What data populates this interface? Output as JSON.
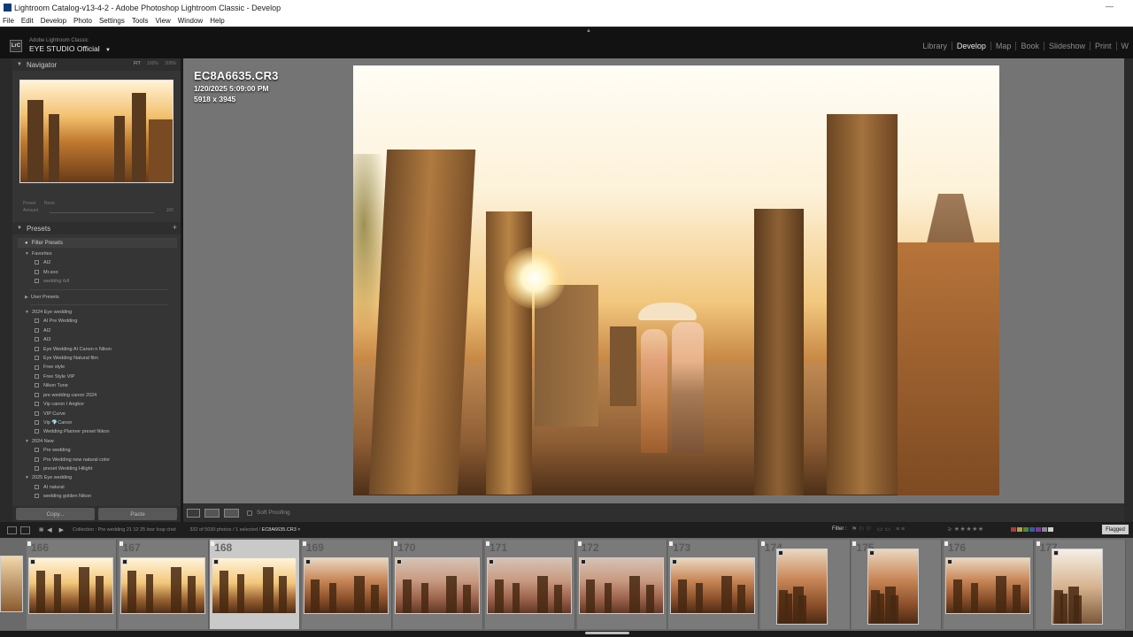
{
  "window": {
    "title": "Lightroom Catalog-v13-4-2 - Adobe Photoshop Lightroom Classic - Develop",
    "minimize": "—"
  },
  "menu": [
    "File",
    "Edit",
    "Develop",
    "Photo",
    "Settings",
    "Tools",
    "View",
    "Window",
    "Help"
  ],
  "identity": {
    "badge": "LrC",
    "app_small": "Adobe Lightroom Classic",
    "studio": "EYE STUDIO Official",
    "caret": "▼"
  },
  "modules": [
    "Library",
    "Develop",
    "Map",
    "Book",
    "Slideshow",
    "Print",
    "W"
  ],
  "active_module": "Develop",
  "navigator": {
    "title": "Navigator",
    "zoom_fit": "FIT",
    "zoom_100": "100%",
    "zoom_200": "200%"
  },
  "preset_strength": {
    "preset_label": "Preset",
    "preset_value": "None",
    "amount_label": "Amount",
    "amount_value": "100"
  },
  "presets": {
    "title": "Presets",
    "filter": "Filter Presets",
    "tree": [
      {
        "type": "group",
        "label": "Favorites"
      },
      {
        "type": "item",
        "label": "AI2"
      },
      {
        "type": "item",
        "label": "Mr.soo"
      },
      {
        "type": "item",
        "label": "wedding full",
        "dim": true
      },
      {
        "type": "sep"
      },
      {
        "type": "group",
        "label": "User Presets",
        "collapsed": true
      },
      {
        "type": "sep"
      },
      {
        "type": "group",
        "label": "2024 Eye wedding"
      },
      {
        "type": "item",
        "label": "AI Pre Wedding"
      },
      {
        "type": "item",
        "label": "AI2"
      },
      {
        "type": "item",
        "label": "AI3"
      },
      {
        "type": "item",
        "label": "Eye Wedding AI Canon n Nikon"
      },
      {
        "type": "item",
        "label": "Eye Wedding Natural film"
      },
      {
        "type": "item",
        "label": "Free style"
      },
      {
        "type": "item",
        "label": "Free Style VIP"
      },
      {
        "type": "item",
        "label": "Nikon Tune"
      },
      {
        "type": "item",
        "label": "pre wedding canon 2024"
      },
      {
        "type": "item",
        "label": "Vip canon I Angkor"
      },
      {
        "type": "item",
        "label": "VIP Curve"
      },
      {
        "type": "item",
        "label": "Vip 💎Canon"
      },
      {
        "type": "item",
        "label": "Wedding Planner preset Nikon"
      },
      {
        "type": "group",
        "label": "2024 New"
      },
      {
        "type": "item",
        "label": "Pre wedding"
      },
      {
        "type": "item",
        "label": "Pre Wedding new natural color"
      },
      {
        "type": "item",
        "label": "preset Wedding Hilight"
      },
      {
        "type": "group",
        "label": "2025 Eye wedding"
      },
      {
        "type": "item",
        "label": "AI natural"
      },
      {
        "type": "item",
        "label": "wedding golden Nikon"
      }
    ]
  },
  "buttons": {
    "copy": "Copy...",
    "paste": "Paste"
  },
  "photo_info": {
    "filename": "EC8A6635.CR3",
    "datetime": "1/20/2025 5:09:00 PM",
    "dimensions": "5918 x 3945"
  },
  "toolbar": {
    "soft_proofing": "Soft Proofing"
  },
  "filmstrip_bar": {
    "collection": "Collection : Pre wedding 21 12 25 loor loop chet",
    "count": "332 of 5030 photos / 1 selected /",
    "current": "EC8A6635.CR3",
    "filter_label": "Filter :",
    "stars": "≥ ★★★★★",
    "flagged": "Flagged",
    "label_colors": [
      "#b03a3a",
      "#b0a43a",
      "#4a8a3a",
      "#3a5aa0",
      "#7a3aa0",
      "#888888",
      "#cfcfcf"
    ]
  },
  "filmstrip": {
    "selected": "168",
    "cells": [
      {
        "num": "166",
        "style": "sun"
      },
      {
        "num": "167",
        "style": "sun"
      },
      {
        "num": "168",
        "style": "sun",
        "selected": true
      },
      {
        "num": "169",
        "style": "temple"
      },
      {
        "num": "170",
        "style": "couple"
      },
      {
        "num": "171",
        "style": "couple"
      },
      {
        "num": "172",
        "style": "couple"
      },
      {
        "num": "173",
        "style": "temple"
      },
      {
        "num": "174",
        "style": "temple",
        "portrait": true
      },
      {
        "num": "175",
        "style": "temple",
        "portrait": true
      },
      {
        "num": "176",
        "style": "temple"
      },
      {
        "num": "177",
        "style": "pale",
        "portrait": true
      }
    ]
  }
}
